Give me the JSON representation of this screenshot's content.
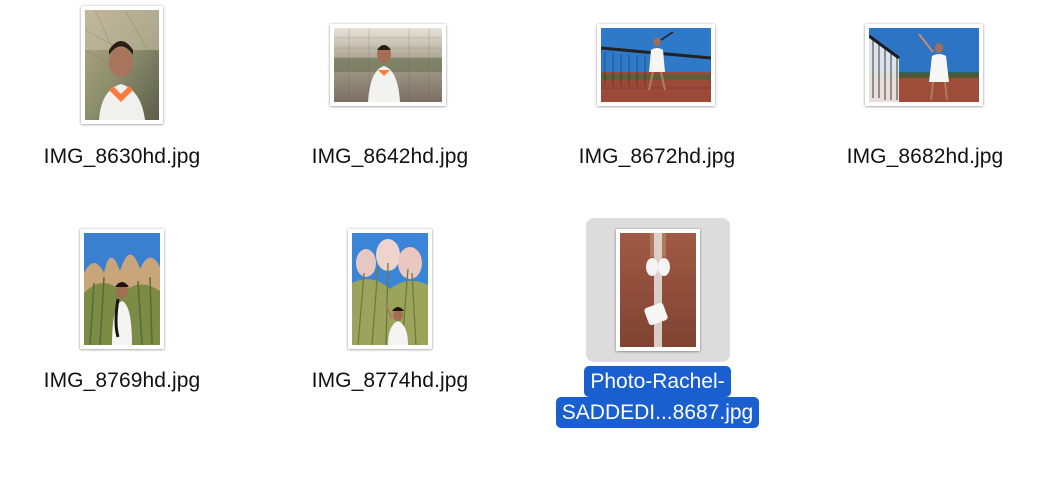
{
  "theme": {
    "selection_color": "#1a5fd0",
    "selected_tile_bg": "#dcdcdc",
    "label_color": "#111111"
  },
  "files": [
    {
      "name": "IMG_8630hd.jpg",
      "icon": "photo-thumbnail-icon",
      "orientation": "portrait",
      "selected": false
    },
    {
      "name": "IMG_8642hd.jpg",
      "icon": "photo-thumbnail-icon",
      "orientation": "landscape",
      "selected": false
    },
    {
      "name": "IMG_8672hd.jpg",
      "icon": "photo-thumbnail-icon",
      "orientation": "landscape",
      "selected": false
    },
    {
      "name": "IMG_8682hd.jpg",
      "icon": "photo-thumbnail-icon",
      "orientation": "landscape",
      "selected": false
    },
    {
      "name": "IMG_8769hd.jpg",
      "icon": "photo-thumbnail-icon",
      "orientation": "portrait",
      "selected": false
    },
    {
      "name": "IMG_8774hd.jpg",
      "icon": "photo-thumbnail-icon",
      "orientation": "portrait",
      "selected": false
    },
    {
      "name_line1": "Photo-Rachel-",
      "name_line2": "SADDEDI...8687.jpg",
      "icon": "photo-thumbnail-icon",
      "orientation": "portrait",
      "selected": true
    }
  ]
}
